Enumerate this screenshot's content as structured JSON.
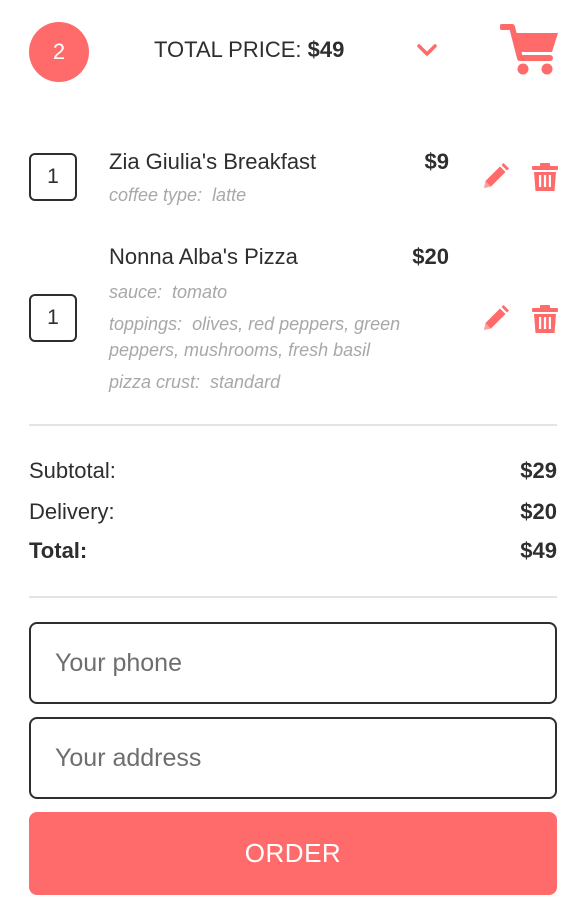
{
  "header": {
    "item_count": "2",
    "total_label": "TOTAL PRICE:",
    "total_value": "$49",
    "icons": {
      "toggle": "chevron-down-icon",
      "cart": "shopping-cart-icon"
    }
  },
  "items": [
    {
      "qty": "1",
      "name": "Zia Giulia's Breakfast",
      "price": "$9",
      "options": [
        {
          "key": "coffee type:",
          "value": "latte"
        }
      ]
    },
    {
      "qty": "1",
      "name": "Nonna Alba's Pizza",
      "price": "$20",
      "options": [
        {
          "key": "sauce:",
          "value": "tomato"
        },
        {
          "key": "toppings:",
          "value": "olives, red peppers, green peppers, mushrooms, fresh basil"
        },
        {
          "key": "pizza crust:",
          "value": "standard"
        }
      ]
    }
  ],
  "summary": {
    "subtotal_label": "Subtotal:",
    "subtotal_value": "$29",
    "delivery_label": "Delivery:",
    "delivery_value": "$20",
    "total_label": "Total:",
    "total_value": "$49"
  },
  "form": {
    "phone_placeholder": "Your phone",
    "address_placeholder": "Your address",
    "order_label": "ORDER"
  },
  "colors": {
    "accent": "#ff6b6b",
    "text": "#2e2e2e",
    "muted": "#a8a8a8"
  }
}
